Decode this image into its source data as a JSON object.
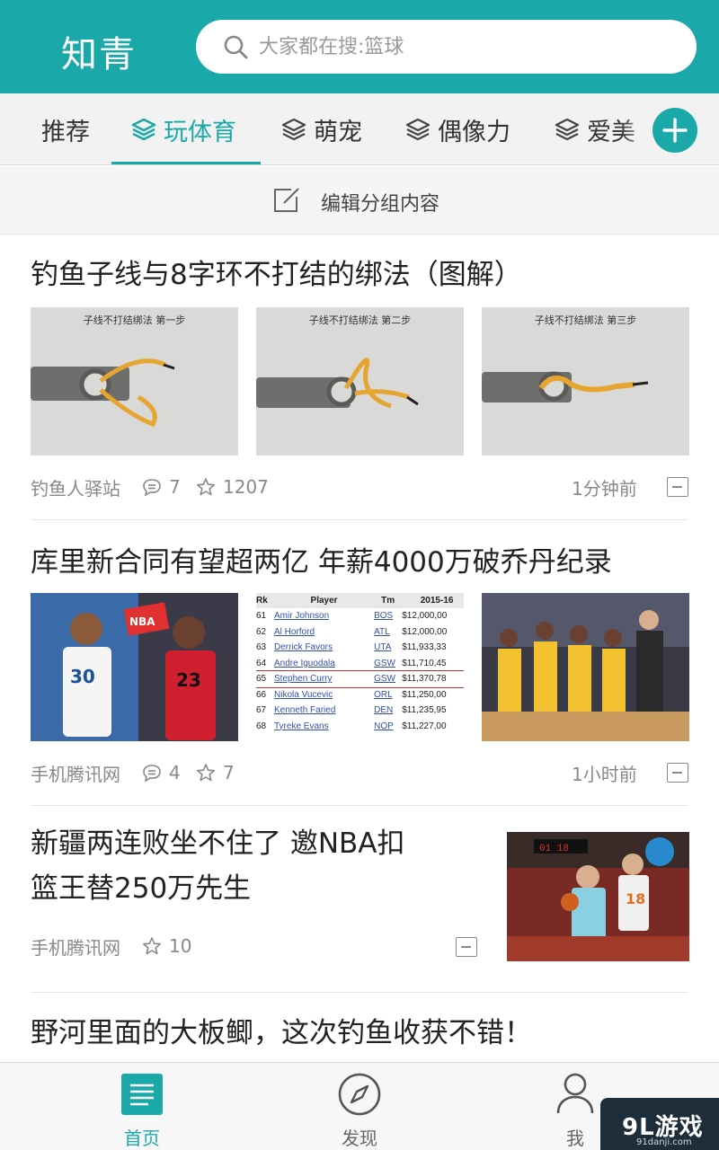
{
  "header": {
    "title": "知青",
    "search_placeholder": "大家都在搜:篮球"
  },
  "tabs": [
    {
      "label": "推荐",
      "active": false
    },
    {
      "label": "玩体育",
      "active": true
    },
    {
      "label": "萌宠",
      "active": false
    },
    {
      "label": "偶像力",
      "active": false
    },
    {
      "label": "爱美",
      "active": false
    }
  ],
  "edit_group": {
    "label": "编辑分组内容"
  },
  "articles": [
    {
      "title": "钓鱼子线与8字环不打结的绑法（图解）",
      "image_captions": [
        "子线不打结绑法 第一步",
        "子线不打结绑法 第二步",
        "子线不打结绑法 第三步"
      ],
      "source": "钓鱼人驿站",
      "comments": "7",
      "stars": "1207",
      "time": "1分钟前"
    },
    {
      "title": "库里新合同有望超两亿 年薪4000万破乔丹纪录",
      "table": {
        "headers": [
          "Rk",
          "Player",
          "Tm",
          "2015-16"
        ],
        "rows": [
          [
            "61",
            "Amir Johnson",
            "BOS",
            "$12,000,00"
          ],
          [
            "62",
            "Al Horford",
            "ATL",
            "$12,000,00"
          ],
          [
            "63",
            "Derrick Favors",
            "UTA",
            "$11,933,33"
          ],
          [
            "64",
            "Andre Iguodala",
            "GSW",
            "$11,710,45"
          ],
          [
            "65",
            "Stephen Curry",
            "GSW",
            "$11,370,78"
          ],
          [
            "66",
            "Nikola Vucevic",
            "ORL",
            "$11,250,00"
          ],
          [
            "67",
            "Kenneth Faried",
            "DEN",
            "$11,235,95"
          ],
          [
            "68",
            "Tyreke Evans",
            "NOP",
            "$11,227,00"
          ]
        ]
      },
      "source": "手机腾讯网",
      "comments": "4",
      "stars": "7",
      "time": "1小时前"
    },
    {
      "title_line1": "新疆两连败坐不住了 邀NBA扣",
      "title_line2": "篮王替250万先生",
      "source": "手机腾讯网",
      "stars": "10"
    },
    {
      "title": "野河里面的大板鲫，这次钓鱼收获不错！"
    }
  ],
  "bottom_nav": [
    {
      "label": "首页",
      "active": true
    },
    {
      "label": "发现",
      "active": false
    },
    {
      "label": "我",
      "active": false
    }
  ],
  "watermark": {
    "text": "9L游戏",
    "sub": "91danji.com"
  },
  "colors": {
    "accent": "#1ba8a8",
    "text": "#222222",
    "meta": "#888888"
  }
}
